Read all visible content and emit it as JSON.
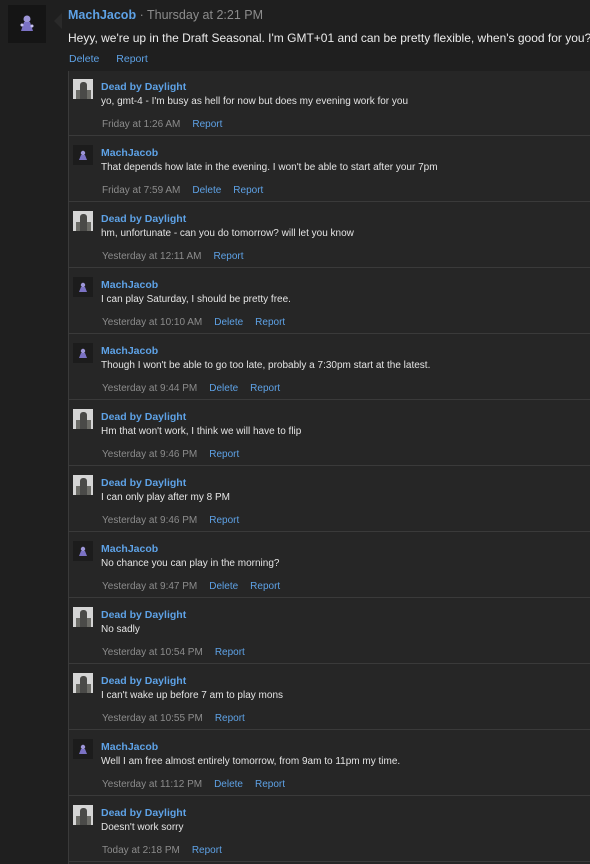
{
  "post": {
    "author": "MachJacob",
    "timestamp": " · Thursday at 2:21 PM",
    "text": "Heyy, we're up in the Draft Seasonal. I'm GMT+01 and can be pretty flexible, when's good for you?",
    "actions": {
      "delete": "Delete",
      "report": "Report"
    }
  },
  "replies": [
    {
      "author": "Dead by Daylight",
      "text": "yo, gmt-4 - I'm busy as hell for now but does my evening work for you",
      "time": "Friday at 1:26 AM",
      "actions": [
        "Report"
      ]
    },
    {
      "author": "MachJacob",
      "text": "That depends how late in the evening. I won't be able to start after your 7pm",
      "time": "Friday at 7:59 AM",
      "actions": [
        "Delete",
        "Report"
      ]
    },
    {
      "author": "Dead by Daylight",
      "text": "hm, unfortunate - can you do tomorrow? will let you know",
      "time": "Yesterday at 12:11 AM",
      "actions": [
        "Report"
      ]
    },
    {
      "author": "MachJacob",
      "text": "I can play Saturday, I should be pretty free.",
      "time": "Yesterday at 10:10 AM",
      "actions": [
        "Delete",
        "Report"
      ]
    },
    {
      "author": "MachJacob",
      "text": "Though I won't be able to go too late, probably a 7:30pm start at the latest.",
      "time": "Yesterday at 9:44 PM",
      "actions": [
        "Delete",
        "Report"
      ]
    },
    {
      "author": "Dead by Daylight",
      "text": "Hm that won't work, I think we will have to flip",
      "time": "Yesterday at 9:46 PM",
      "actions": [
        "Report"
      ]
    },
    {
      "author": "Dead by Daylight",
      "text": "I can only play after my 8 PM",
      "time": "Yesterday at 9:46 PM",
      "actions": [
        "Report"
      ]
    },
    {
      "author": "MachJacob",
      "text": "No chance you can play in the morning?",
      "time": "Yesterday at 9:47 PM",
      "actions": [
        "Delete",
        "Report"
      ]
    },
    {
      "author": "Dead by Daylight",
      "text": "No sadly",
      "time": "Yesterday at 10:54 PM",
      "actions": [
        "Report"
      ]
    },
    {
      "author": "Dead by Daylight",
      "text": "I can't wake up before 7 am to play mons",
      "time": "Yesterday at 10:55 PM",
      "actions": [
        "Report"
      ]
    },
    {
      "author": "MachJacob",
      "text": "Well I am free almost entirely tomorrow, from 9am to 11pm my time.",
      "time": "Yesterday at 11:12 PM",
      "actions": [
        "Delete",
        "Report"
      ]
    },
    {
      "author": "Dead by Daylight",
      "text": "Doesn't work sorry",
      "time": "Today at 2:18 PM",
      "actions": [
        "Report"
      ]
    }
  ],
  "colors": {
    "link": "#5ea2e6",
    "background": "#1f1f1f",
    "reply_background": "#262626",
    "meta": "#8c8c8c"
  }
}
